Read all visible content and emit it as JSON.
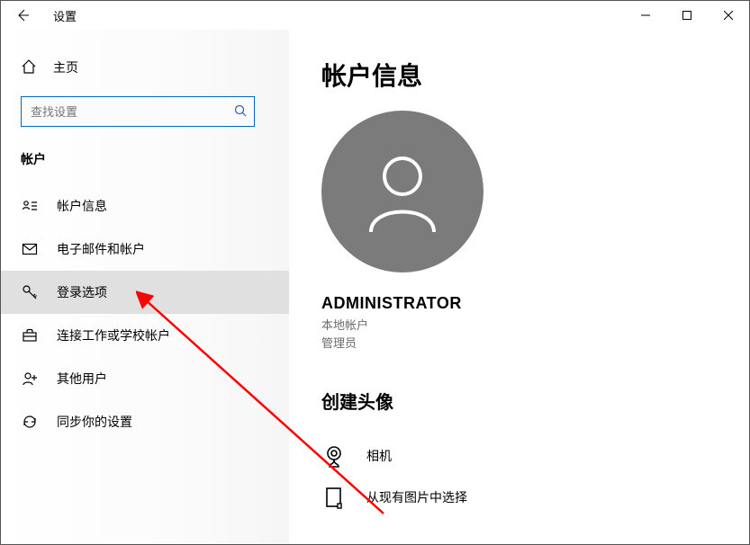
{
  "window": {
    "title": "设置"
  },
  "sidebar": {
    "home": "主页",
    "search_placeholder": "查找设置",
    "section": "帐户",
    "items": [
      {
        "label": "帐户信息"
      },
      {
        "label": "电子邮件和帐户"
      },
      {
        "label": "登录选项"
      },
      {
        "label": "连接工作或学校帐户"
      },
      {
        "label": "其他用户"
      },
      {
        "label": "同步你的设置"
      }
    ]
  },
  "main": {
    "page_title": "帐户信息",
    "user_name": "ADMINISTRATOR",
    "user_type": "本地帐户",
    "user_role": "管理员",
    "create_avatar_heading": "创建头像",
    "options": [
      {
        "label": "相机"
      },
      {
        "label": "从现有图片中选择"
      }
    ]
  }
}
